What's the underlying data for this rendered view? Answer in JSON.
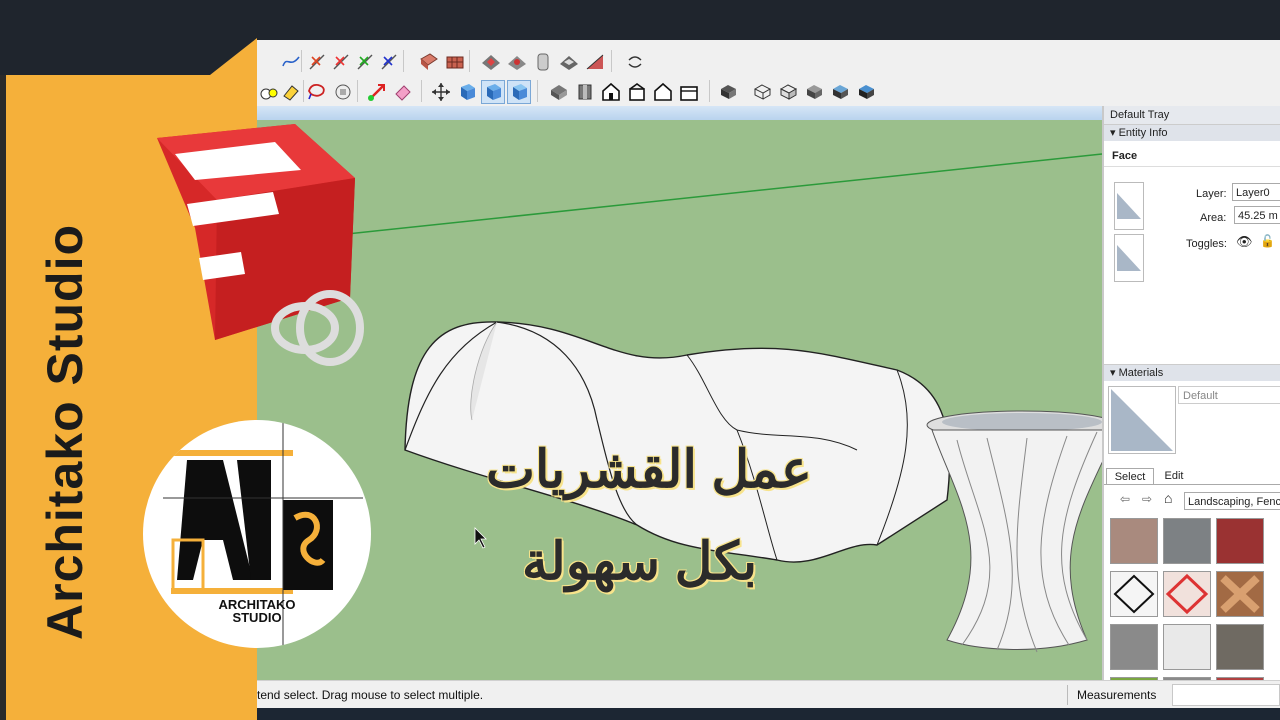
{
  "brand": {
    "vertical_title": "Architako Studio",
    "logo_line1": "ARCHITAKO",
    "logo_line2": "STUDIO"
  },
  "overlay": {
    "line1": "عمل القشريات",
    "line2": "بكل سهولة"
  },
  "tray": {
    "title": "Default Tray",
    "entity_info": {
      "header": "Entity Info",
      "type": "Face",
      "layer_label": "Layer:",
      "layer_value": "Layer0",
      "area_label": "Area:",
      "area_value": "45.25 m",
      "toggles_label": "Toggles:"
    },
    "materials": {
      "header": "Materials",
      "default_name": "Default",
      "tab_select": "Select",
      "tab_edit": "Edit",
      "library": "Landscaping, Fencing"
    }
  },
  "status": {
    "hint": "tend select. Drag mouse to select multiple.",
    "measurements_label": "Measurements"
  },
  "colors": {
    "sidebar": "#f5b03a",
    "viewport": "#9bbf8c",
    "sketchup_red": "#e0282a"
  },
  "material_swatches": [
    "brick-paving",
    "stone",
    "red-gravel",
    "chain-link",
    "red-lattice",
    "wood-lattice",
    "wood-fence",
    "white-fence",
    "shingles",
    "grass",
    "gravel",
    "red-gravel-2"
  ]
}
